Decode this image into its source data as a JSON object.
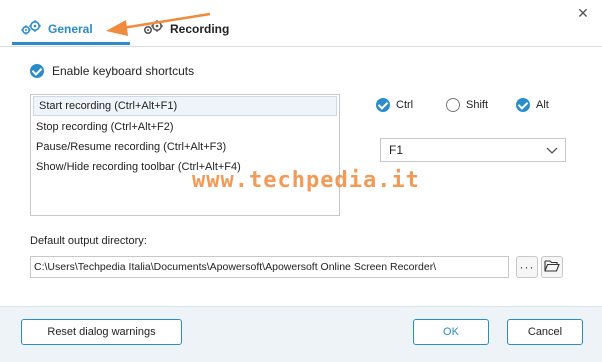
{
  "tabs": {
    "general_label": "General",
    "recording_label": "Recording"
  },
  "shortcuts": {
    "enable_label": "Enable keyboard shortcuts",
    "enabled": true,
    "items": [
      "Start recording (Ctrl+Alt+F1)",
      "Stop recording (Ctrl+Alt+F2)",
      "Pause/Resume recording (Ctrl+Alt+F3)",
      "Show/Hide recording toolbar (Ctrl+Alt+F4)"
    ],
    "selected_index": 0,
    "modifiers": {
      "ctrl_label": "Ctrl",
      "ctrl_checked": true,
      "shift_label": "Shift",
      "shift_checked": false,
      "alt_label": "Alt",
      "alt_checked": true
    },
    "key_value": "F1"
  },
  "watermark": "www.techpedia.it",
  "output": {
    "label": "Default output directory:",
    "path": "C:\\Users\\Techpedia Italia\\Documents\\Apowersoft\\Apowersoft Online Screen Recorder\\",
    "browse_label": "···"
  },
  "footer": {
    "reset_label": "Reset dialog warnings",
    "ok_label": "OK",
    "cancel_label": "Cancel"
  },
  "colors": {
    "accent": "#2a8cc9",
    "annotation_arrow": "#f08a3d",
    "footer_bg": "#eef3f8"
  },
  "icons": {
    "general_tab": "gears-icon",
    "recording_tab": "gears-icon",
    "close": "close-icon",
    "dropdown": "chevron-down-icon",
    "folder": "folder-open-icon"
  }
}
